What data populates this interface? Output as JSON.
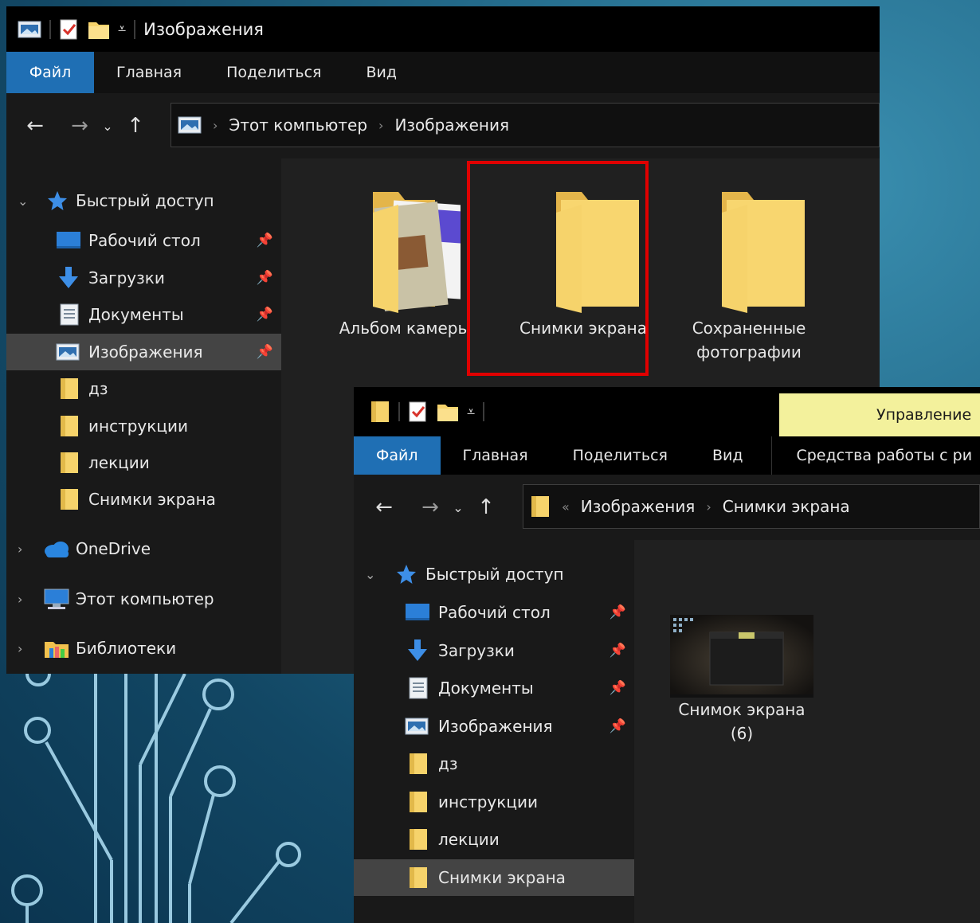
{
  "window1": {
    "title": "Изображения",
    "ribbon_tabs": [
      "Файл",
      "Главная",
      "Поделиться",
      "Вид"
    ],
    "breadcrumb": [
      "Этот компьютер",
      "Изображения"
    ],
    "nav_quick_access": "Быстрый доступ",
    "nav_items": [
      {
        "label": "Рабочий стол",
        "icon": "desktop-icon",
        "pinned": true
      },
      {
        "label": "Загрузки",
        "icon": "download-icon",
        "pinned": true
      },
      {
        "label": "Документы",
        "icon": "document-icon",
        "pinned": true
      },
      {
        "label": "Изображения",
        "icon": "pictures-icon",
        "pinned": true,
        "selected": true
      },
      {
        "label": "дз",
        "icon": "folder-icon"
      },
      {
        "label": "инструкции",
        "icon": "folder-icon"
      },
      {
        "label": "лекции",
        "icon": "folder-icon"
      },
      {
        "label": "Снимки экрана",
        "icon": "folder-icon"
      }
    ],
    "nav_onedrive": "OneDrive",
    "nav_this_pc": "Этот компьютер",
    "nav_libraries": "Библиотеки",
    "folders": [
      {
        "line1": "Альбом камеры",
        "line2": ""
      },
      {
        "line1": "Снимки экрана",
        "line2": "",
        "highlighted": true
      },
      {
        "line1": "Сохраненные",
        "line2": "фотографии"
      }
    ]
  },
  "window2": {
    "manage_label": "Управление",
    "ribbon_tabs": [
      "Файл",
      "Главная",
      "Поделиться",
      "Вид",
      "Средства работы с ри"
    ],
    "breadcrumb_prefix": "«",
    "breadcrumb": [
      "Изображения",
      "Снимки экрана"
    ],
    "nav_quick_access": "Быстрый доступ",
    "nav_items": [
      {
        "label": "Рабочий стол",
        "icon": "desktop-icon",
        "pinned": true
      },
      {
        "label": "Загрузки",
        "icon": "download-icon",
        "pinned": true
      },
      {
        "label": "Документы",
        "icon": "document-icon",
        "pinned": true
      },
      {
        "label": "Изображения",
        "icon": "pictures-icon",
        "pinned": true
      },
      {
        "label": "дз",
        "icon": "folder-icon"
      },
      {
        "label": "инструкции",
        "icon": "folder-icon"
      },
      {
        "label": "лекции",
        "icon": "folder-icon"
      },
      {
        "label": "Снимки экрана",
        "icon": "folder-icon",
        "selected": true
      }
    ],
    "file": {
      "line1": "Снимок экрана",
      "line2": "(6)"
    }
  },
  "colors": {
    "accent": "#1f6fb4",
    "highlight": "#e00000",
    "folder": "#f6d36b",
    "manage": "#f3f19c"
  }
}
